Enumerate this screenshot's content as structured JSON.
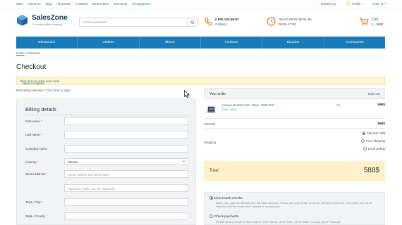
{
  "colors": {
    "accent": "#1a7bb9",
    "link": "#1e6fa6",
    "orange": "#e67e22",
    "coupon_bg": "#fdf6d6",
    "total_bg": "#fdf1cc"
  },
  "topbar": {
    "links": [
      "Main",
      "About Us",
      "Blog",
      "All brands",
      "Contacts",
      "Best sellers",
      "Discounts",
      "All categories"
    ],
    "wishlist": "Wishlist (4)",
    "profile": "Profile",
    "currency": "USD, $"
  },
  "header": {
    "logo_name": "SalesZone",
    "logo_tagline": "For easily online shopping",
    "search_placeholder": "Search products",
    "phone": "0 800 123-45-67",
    "callback": "Callback",
    "hours_line1": "Пн–Сб 09:00–20:00, Вс",
    "hours_line2": "09:00–17:00",
    "cart_label": "Cart",
    "cart_info": "1 - 568$"
  },
  "nav": [
    "Electronics",
    "Clothes",
    "Shoes",
    "Furniture",
    "Bicycles",
    "Accessories"
  ],
  "breadcrumb": {
    "home": "Home",
    "sep": " / ",
    "current": "Checkout"
  },
  "page_title": "Checkout",
  "coupon": {
    "text": "Have a coupon? ",
    "link": "Click here to enter your code"
  },
  "returning": {
    "text": "Returning customer? ",
    "link": "Click here to login"
  },
  "billing": {
    "title": "Billing details",
    "fields": [
      {
        "label": "First name",
        "required": "*",
        "value": ""
      },
      {
        "label": "Last name",
        "required": "*",
        "value": ""
      },
      {
        "label": "Company name",
        "required": "",
        "value": ""
      },
      {
        "label": "Country",
        "required": "*",
        "value": "Ukraine"
      },
      {
        "label": "Street address",
        "required": "*",
        "value": "House number and street name"
      },
      {
        "label": "",
        "required": "",
        "value": "Apartment, suite, unit etc. (optional)"
      },
      {
        "label": "Town / City",
        "required": "*",
        "value": ""
      },
      {
        "label": "State / County",
        "required": "*",
        "value": ""
      }
    ]
  },
  "order": {
    "title": "Your order",
    "edit": "Edit cart",
    "item_name": "Lenovo IdeaPad 320 - Black, 2300 MHz",
    "item_price": "Price: 568$",
    "item_qty": "×1",
    "item_total": "568$",
    "subtotal_label": "Subtotal",
    "subtotal_value": "568$",
    "shipping_label": "Shipping",
    "shipping_options": [
      "Flat rate: 20$",
      "Free shipping",
      "Local pickup"
    ],
    "shipping_selected": 0,
    "total_label": "Total",
    "total_value": "588$"
  },
  "payment": {
    "methods": [
      {
        "name": "Direct bank transfer",
        "desc": "Make your payment directly into our bank account. Please use your Order ID as the payment reference. Your order will not be shipped until the funds have cleared in our account."
      },
      {
        "name": "Check payments",
        "desc": "Please send a check to Store Name, Store Street, Store Town, Store State / County, Store Postcode."
      }
    ],
    "selected": 0
  }
}
